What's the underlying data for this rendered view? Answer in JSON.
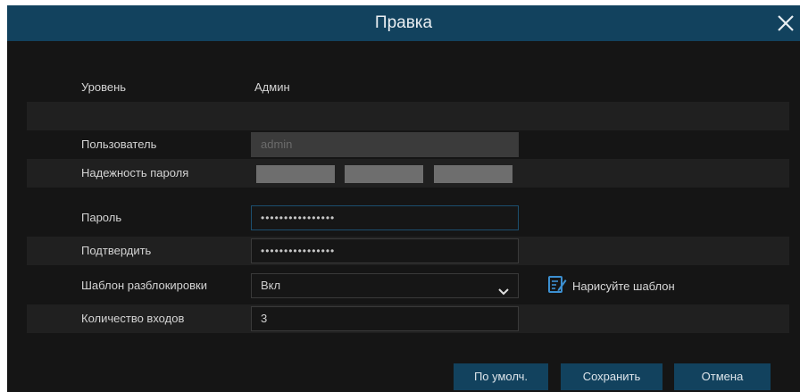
{
  "dialog": {
    "title": "Правка",
    "close_icon": "close-icon"
  },
  "form": {
    "level": {
      "label": "Уровень",
      "value": "Админ"
    },
    "user": {
      "label": "Пользователь",
      "value": "admin"
    },
    "strength": {
      "label": "Надежность пароля",
      "filled_segments": 0,
      "total_segments": 3
    },
    "password": {
      "label": "Пароль",
      "value": "••••••••••••••••"
    },
    "confirm": {
      "label": "Подтвердить",
      "value": "••••••••••••••••"
    },
    "unlock_pattern": {
      "label": "Шаблон разблокировки",
      "selected": "Вкл",
      "draw_link": "Нарисуйте шаблон",
      "draw_icon": "edit-pattern-icon"
    },
    "login_count": {
      "label": "Количество входов",
      "value": "3"
    }
  },
  "buttons": {
    "default": "По умолч.",
    "save": "Сохранить",
    "cancel": "Отмена"
  },
  "colors": {
    "accent": "#12425e",
    "panel": "#151515",
    "shade_row": "#202020",
    "strength_bar": "#6e6e6e"
  }
}
